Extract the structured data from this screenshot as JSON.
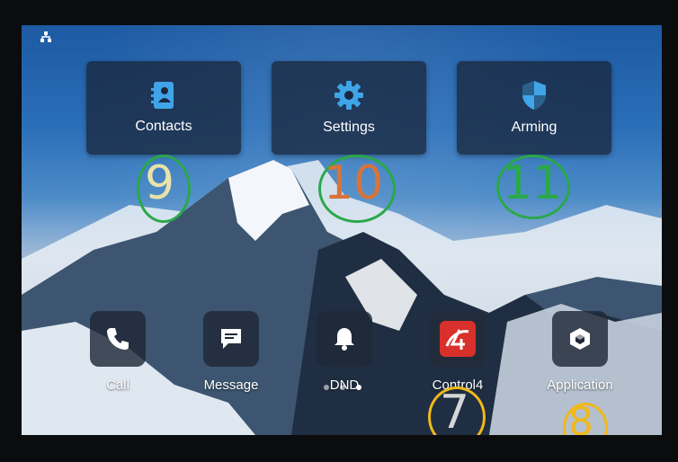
{
  "status_bar": {
    "network_icon": "network-icon"
  },
  "top_tiles": [
    {
      "label": "Contacts",
      "icon": "contacts-icon"
    },
    {
      "label": "Settings",
      "icon": "gear-icon"
    },
    {
      "label": "Arming",
      "icon": "shield-icon"
    }
  ],
  "dock": [
    {
      "label": "Call",
      "icon": "phone-icon"
    },
    {
      "label": "Message",
      "icon": "message-icon"
    },
    {
      "label": "DND",
      "icon": "bell-icon"
    },
    {
      "label": "Control4",
      "icon": "control4-icon"
    },
    {
      "label": "Application",
      "icon": "cube-icon"
    }
  ],
  "page_indicator": {
    "count": 3,
    "active_index": 2
  },
  "annotations": [
    {
      "text": "9",
      "color": "#e8e3a8",
      "ring_color": "#2aa84a"
    },
    {
      "text": "10",
      "color": "#d8733a",
      "ring_color": "#2aa84a"
    },
    {
      "text": "11",
      "color": "#2aa84a",
      "ring_color": "#2aa84a"
    },
    {
      "text": "7",
      "color": "#d6d6d6",
      "ring_color": "#f0b81a"
    },
    {
      "text": "8",
      "color": "#f0b81a",
      "ring_color": "#f0b81a"
    }
  ],
  "colors": {
    "tile_bg": "#19283e",
    "control4_red": "#d8302a",
    "green_annotation": "#2aa84a",
    "yellow_annotation": "#f0b81a"
  }
}
